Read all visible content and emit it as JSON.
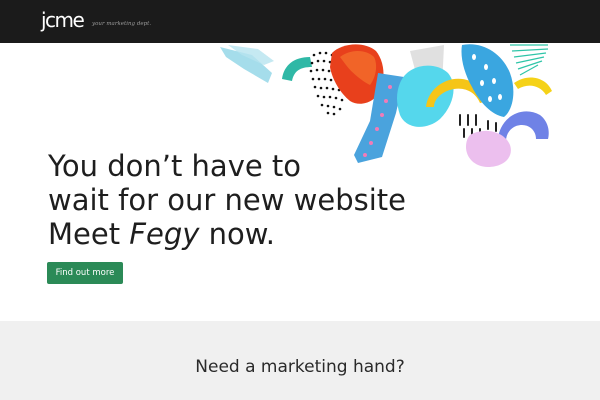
{
  "header": {
    "logo_text": "jcme",
    "tagline": "your marketing dept."
  },
  "hero": {
    "headline_line1": "You don’t have to",
    "headline_line2": "wait for our new website",
    "headline_line3_prefix": "Meet ",
    "headline_line3_emphasis": "Fegy",
    "headline_line3_suffix": " now.",
    "cta_label": "Find out more"
  },
  "band": {
    "title": "Need a marketing hand?"
  },
  "colors": {
    "topbar_bg": "#1b1b1b",
    "cta_bg": "#2b8a57",
    "band_bg": "#f0f0f0"
  }
}
